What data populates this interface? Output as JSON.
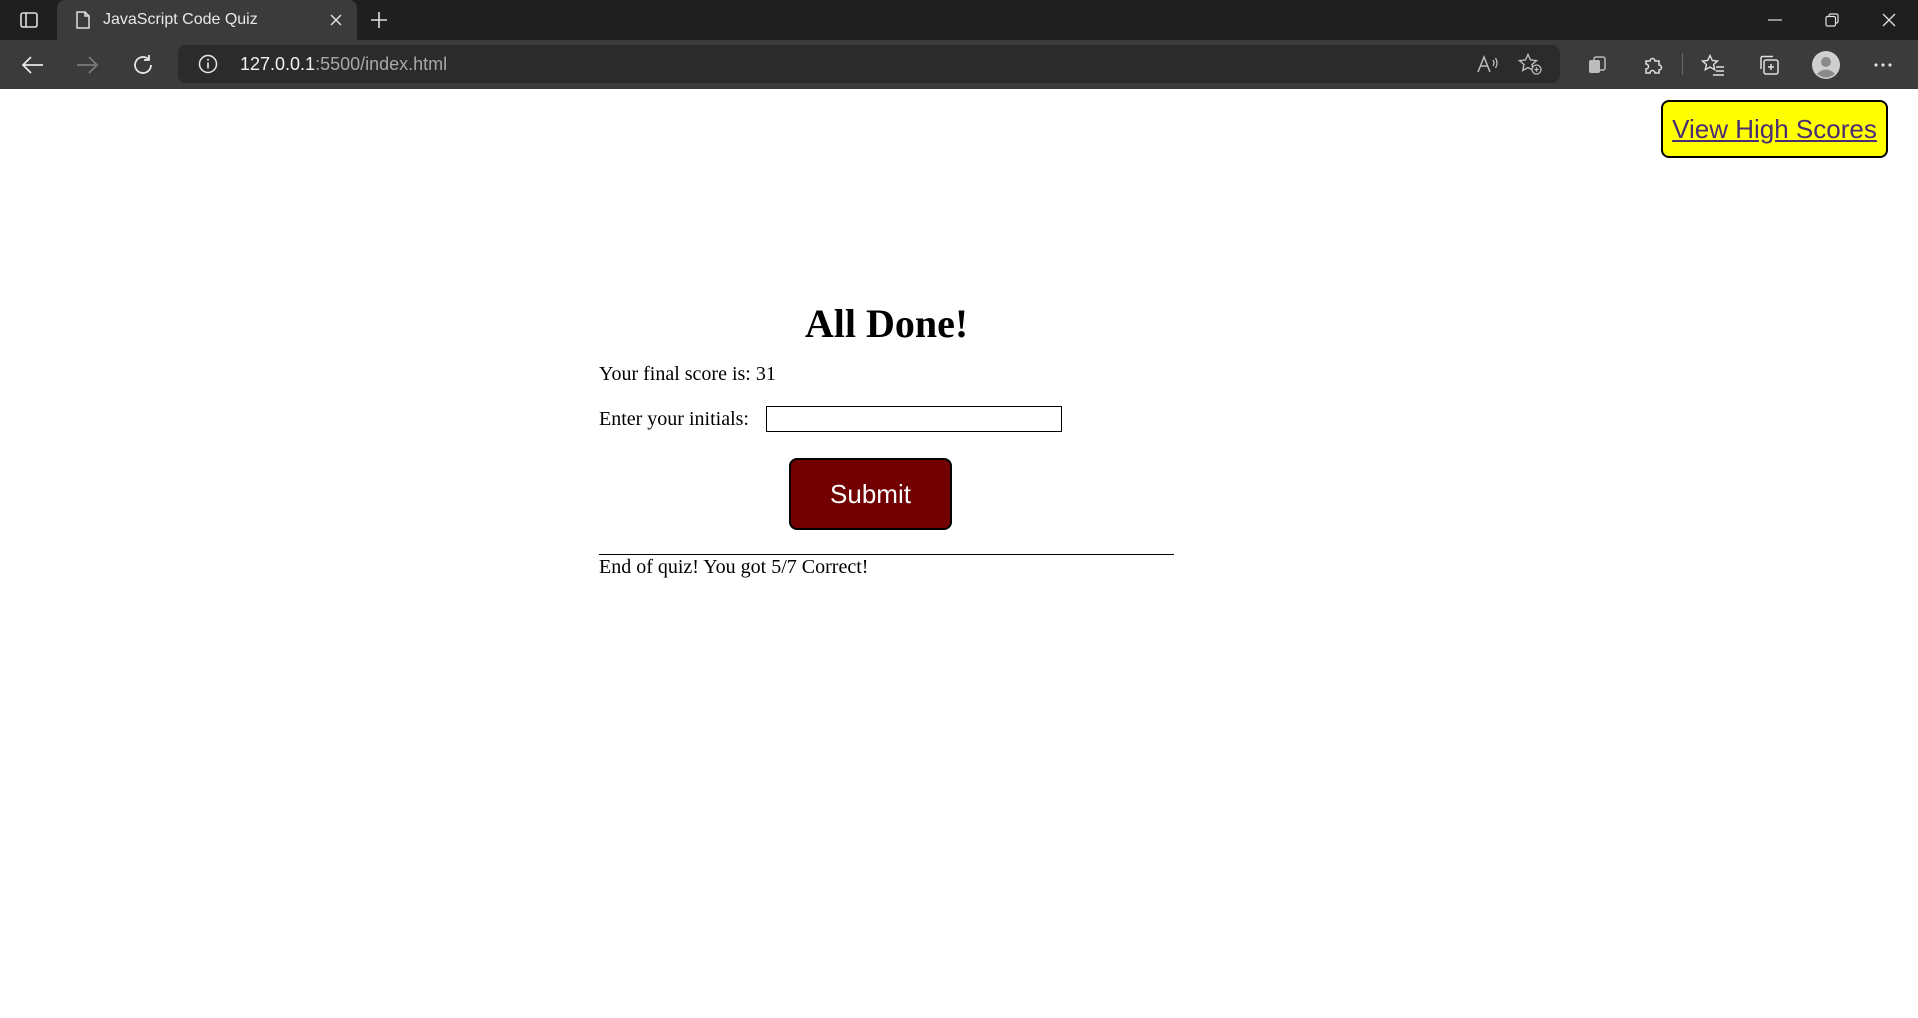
{
  "browser": {
    "tab": {
      "title": "JavaScript Code Quiz",
      "favicon": "page-icon"
    },
    "address": {
      "host": "127.0.0.1",
      "rest": ":5500/index.html"
    },
    "icons": {
      "tab_actions": "tab-actions-icon",
      "close_tab": "close-icon",
      "new_tab": "plus-icon",
      "minimize": "minimize-icon",
      "restore": "restore-icon",
      "close_window": "close-icon",
      "back": "back-arrow-icon",
      "forward": "forward-arrow-icon",
      "refresh": "refresh-icon",
      "site_info": "info-icon",
      "read_aloud": "read-aloud-icon",
      "add_favorite": "star-add-icon",
      "extensions_app": "app-icon",
      "extensions": "puzzle-icon",
      "favorites": "favorites-icon",
      "collections": "collections-icon",
      "profile": "profile-icon",
      "menu": "more-icon"
    },
    "colors": {
      "tabbar_bg": "#1f1f1f",
      "toolbar_bg": "#3b3b3b",
      "address_bg": "#2b2b2b"
    }
  },
  "page": {
    "high_scores_label": "View High Scores",
    "heading": "All Done!",
    "final_score_text": "Your final score is: 31",
    "initials_label": "Enter your initials:",
    "initials_value": "",
    "submit_label": "Submit",
    "result_text": "End of quiz! You got 5/7 Correct!",
    "colors": {
      "high_scores_bg": "#ffff00",
      "high_scores_text": "#4a2c75",
      "submit_bg": "#720000",
      "submit_text": "#ffffff"
    }
  }
}
